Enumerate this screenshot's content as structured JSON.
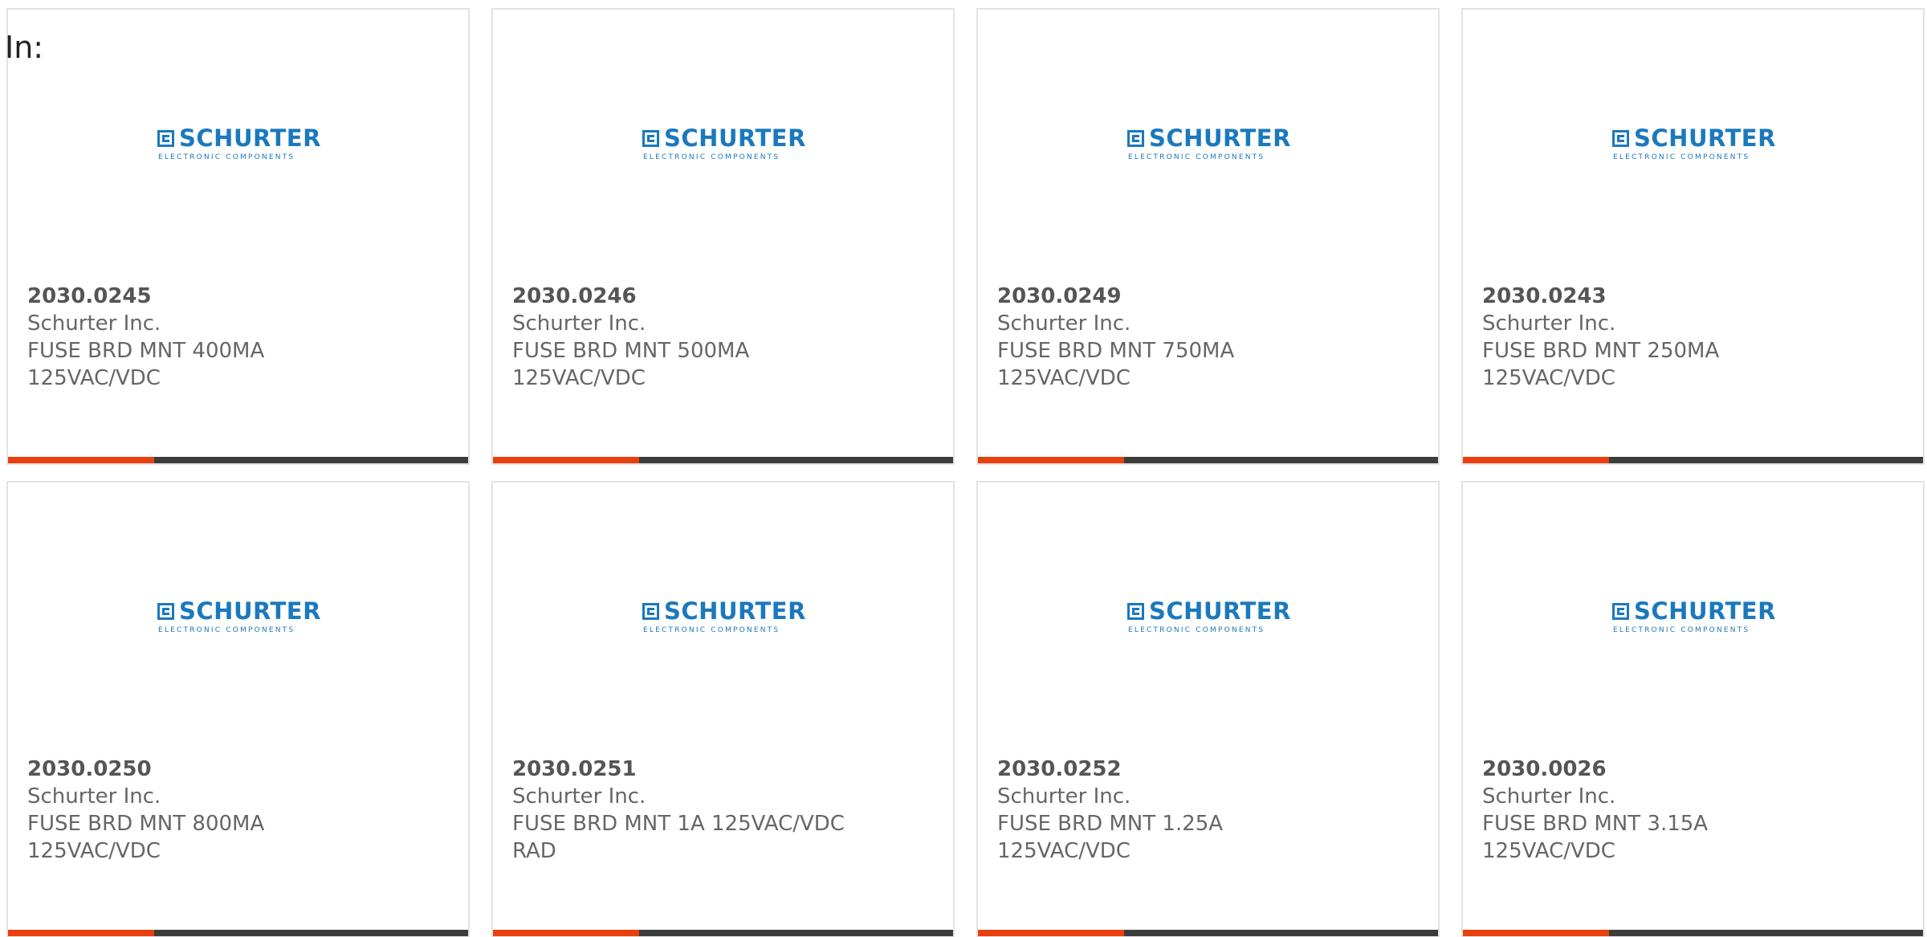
{
  "header": {
    "in_label": "In:"
  },
  "brand": {
    "logo_word": "SCHURTER",
    "logo_sub": "ELECTRONIC COMPONENTS",
    "logo_color": "#1b79bd",
    "accent_color": "#e8400f",
    "bar_color": "#3c3c3c"
  },
  "products": [
    {
      "part_number": "2030.0245",
      "manufacturer": "Schurter Inc.",
      "description": "FUSE BRD MNT 400MA\n125VAC/VDC"
    },
    {
      "part_number": "2030.0246",
      "manufacturer": "Schurter Inc.",
      "description": "FUSE BRD MNT 500MA\n125VAC/VDC"
    },
    {
      "part_number": "2030.0249",
      "manufacturer": "Schurter Inc.",
      "description": "FUSE BRD MNT 750MA\n125VAC/VDC"
    },
    {
      "part_number": "2030.0243",
      "manufacturer": "Schurter Inc.",
      "description": "FUSE BRD MNT 250MA\n125VAC/VDC"
    },
    {
      "part_number": "2030.0250",
      "manufacturer": "Schurter Inc.",
      "description": "FUSE BRD MNT 800MA\n125VAC/VDC"
    },
    {
      "part_number": "2030.0251",
      "manufacturer": "Schurter Inc.",
      "description": "FUSE BRD MNT 1A 125VAC/VDC\nRAD"
    },
    {
      "part_number": "2030.0252",
      "manufacturer": "Schurter Inc.",
      "description": "FUSE BRD MNT 1.25A\n125VAC/VDC"
    },
    {
      "part_number": "2030.0026",
      "manufacturer": "Schurter Inc.",
      "description": "FUSE BRD MNT 3.15A\n125VAC/VDC"
    }
  ]
}
